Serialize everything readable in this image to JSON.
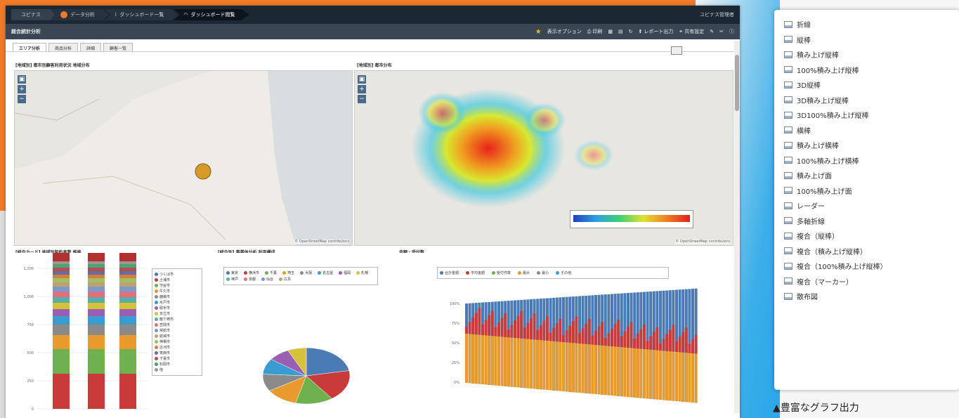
{
  "topbar": {
    "crumbs": [
      "ユビナス",
      "データ分析",
      "ダッシュボード一覧",
      "ダッシュボード閲覧"
    ],
    "user": "ユビナス管理者"
  },
  "toolbar": {
    "title": "総合統計分析",
    "items": [
      "表示オプション",
      "印刷",
      "レポート出力",
      "共有設定"
    ]
  },
  "tabs": [
    "エリア分析",
    "商品分析",
    "詳細",
    "顧客一覧"
  ],
  "panels": {
    "map1": "[地域別] 都市別顧客利用状況 地域分布",
    "map2": "[地域別] 都市分布",
    "bar": "[統合カード] 地域別契約者数 推移",
    "pie": "[統合別] 事業体分析 利用構成",
    "area": "金額・受付数",
    "credit": "© OpenStreetMap contributors"
  },
  "bar_legend": [
    "つくば市",
    "土浦市",
    "守谷市",
    "牛久市",
    "鹿嶋市",
    "水戸市",
    "取手市",
    "日立市",
    "龍ケ崎市",
    "笠間市",
    "常総市",
    "結城市",
    "神栖市",
    "古河市",
    "筑西市",
    "下妻市",
    "石岡市",
    "他"
  ],
  "bar_y": [
    "1,200",
    "1,000",
    "750",
    "500",
    "250",
    "0"
  ],
  "pie_legend": [
    "東京",
    "横浜市",
    "千葉",
    "埼玉",
    "大阪",
    "名古屋",
    "福岡",
    "札幌",
    "神戸",
    "京都",
    "仙台",
    "広島"
  ],
  "area_legend": [
    "合計金額",
    "平均金額",
    "受付件数",
    "最大",
    "最小",
    "その他"
  ],
  "area_y": [
    "100%",
    "75%",
    "50%",
    "25%",
    "0%"
  ],
  "menu": [
    "折線",
    "縦棒",
    "積み上げ縦棒",
    "100%積み上げ縦棒",
    "3D縦棒",
    "3D積み上げ縦棒",
    "3D100%積み上げ縦棒",
    "横棒",
    "積み上げ横棒",
    "100%積み上げ横棒",
    "積み上げ面",
    "100%積み上げ面",
    "レーダー",
    "多軸折線",
    "複合（縦棒）",
    "複合（積み上げ縦棒）",
    "複合（100%積み上げ縦棒）",
    "複合（マーカー）",
    "散布図"
  ],
  "caption": "▲豊富なグラフ出力",
  "colors": {
    "orange": "#f07a2a",
    "navy": "#1c2734",
    "menu_border": "#29a6ea"
  }
}
